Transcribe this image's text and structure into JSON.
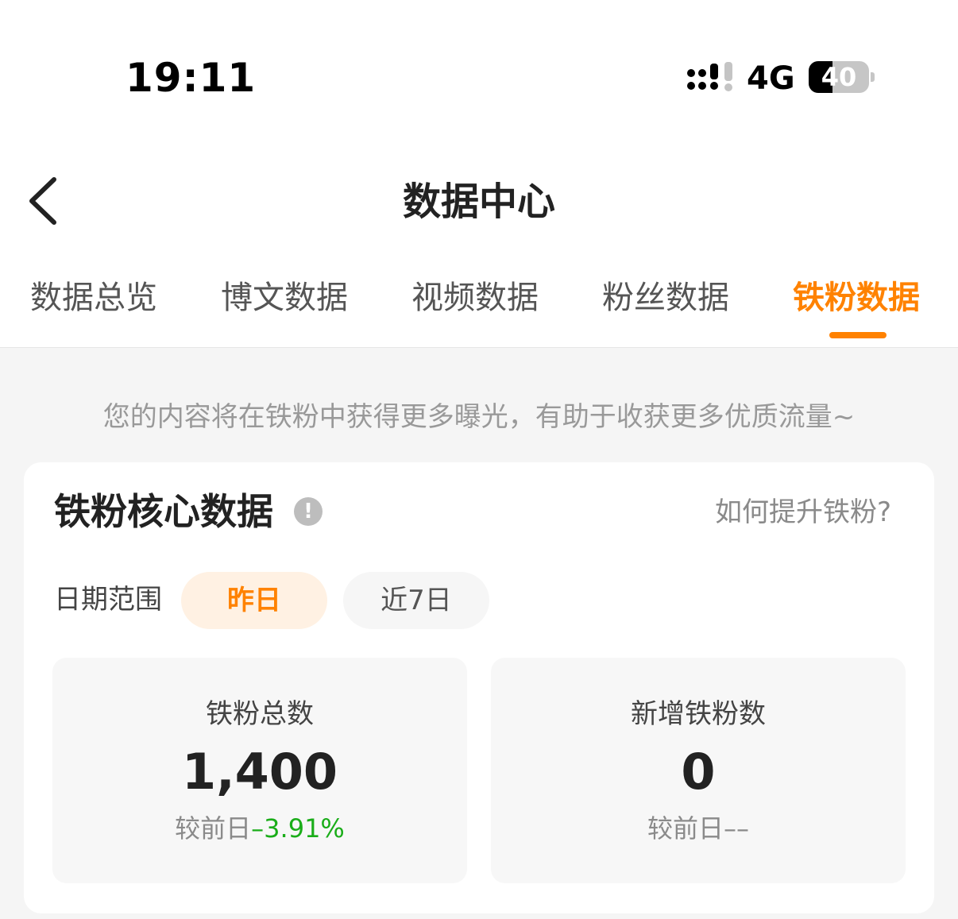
{
  "status_bar": {
    "time": "19:11",
    "network": "4G",
    "battery_level": "40"
  },
  "nav": {
    "title": "数据中心"
  },
  "tabs": [
    {
      "label": "数据总览",
      "active": false
    },
    {
      "label": "博文数据",
      "active": false
    },
    {
      "label": "视频数据",
      "active": false
    },
    {
      "label": "粉丝数据",
      "active": false
    },
    {
      "label": "铁粉数据",
      "active": true
    }
  ],
  "notice": "您的内容将在铁粉中获得更多曝光，有助于收获更多优质流量~",
  "core_card": {
    "title": "铁粉核心数据",
    "info_icon_glyph": "!",
    "help_link": "如何提升铁粉?",
    "date_range": {
      "label": "日期范围",
      "options": [
        {
          "label": "昨日",
          "selected": true
        },
        {
          "label": "近7日",
          "selected": false
        }
      ]
    },
    "stats": [
      {
        "label": "铁粉总数",
        "value": "1,400",
        "compare_prefix": "较前日",
        "compare_value": "–3.91%"
      },
      {
        "label": "新增铁粉数",
        "value": "0",
        "compare_prefix": "较前日",
        "compare_value": "––"
      }
    ]
  },
  "colors": {
    "accent": "#ff8200",
    "decrease": "#1aad19",
    "muted_text": "#999999"
  },
  "icons": {
    "back": "chevron-left-icon",
    "signal": "signal-icon",
    "battery": "battery-icon",
    "info": "info-icon"
  }
}
